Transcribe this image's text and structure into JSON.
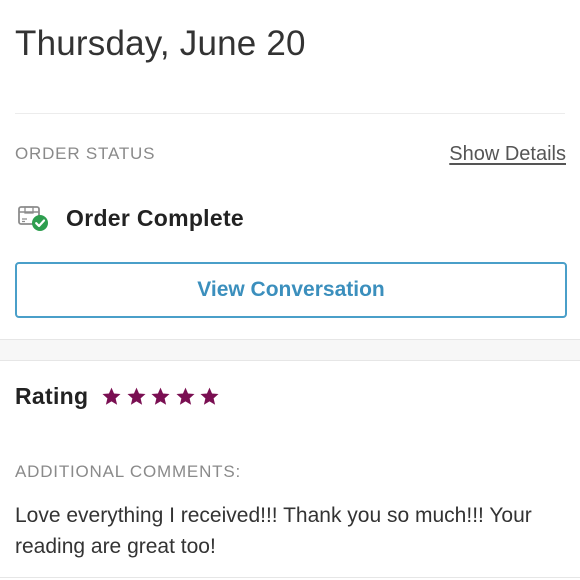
{
  "header": {
    "date": "Thursday, June 20"
  },
  "order_status": {
    "label": "ORDER STATUS",
    "show_details": "Show Details",
    "status_text": "Order Complete",
    "status_icon": "box-check-icon",
    "view_button": "View Conversation"
  },
  "rating": {
    "label": "Rating",
    "stars": 5,
    "max_stars": 5,
    "star_color": "#7a0f52"
  },
  "comments": {
    "label": "ADDITIONAL COMMENTS:",
    "text": "Love everything I received!!! Thank you so much!!! Your reading are great too!"
  },
  "colors": {
    "accent": "#3b8fbd",
    "check_green": "#2e9e4f"
  }
}
